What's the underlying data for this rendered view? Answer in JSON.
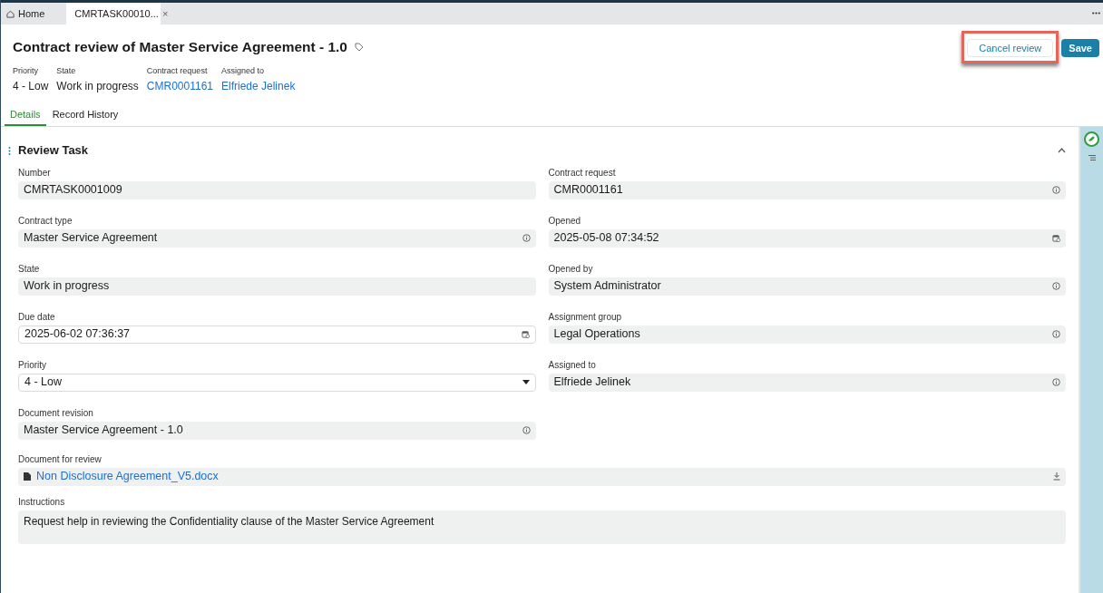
{
  "tabs": [
    {
      "label": "Home",
      "kind": "home",
      "selected": false
    },
    {
      "label": "CMRTASK00010...",
      "kind": "record",
      "close": "×",
      "selected": true
    }
  ],
  "header": {
    "title": "Contract review of Master Service Agreement - 1.0",
    "summary": [
      {
        "label": "Priority",
        "value": "4 - Low",
        "link": false
      },
      {
        "label": "State",
        "value": "Work in progress",
        "link": false
      },
      {
        "label": "Contract request",
        "value": "CMR0001161",
        "link": true
      },
      {
        "label": "Assigned to",
        "value": "Elfriede Jelinek",
        "link": true
      }
    ],
    "buttons": [
      {
        "label": "Cancel review",
        "kind": "secondary",
        "highlighted": true
      },
      {
        "label": "Save",
        "kind": "primary",
        "highlighted": false
      }
    ]
  },
  "record_tabs": [
    {
      "label": "Details",
      "selected": true
    },
    {
      "label": "Record History",
      "selected": false
    }
  ],
  "section": {
    "title": "Review Task",
    "expanded": true,
    "left_fields": [
      {
        "label": "Number",
        "value": "CMRTASK0001009",
        "editable": false,
        "kind": "plain"
      },
      {
        "label": "Contract type",
        "value": "Master Service Agreement",
        "editable": false,
        "kind": "reference"
      },
      {
        "label": "State",
        "value": "Work in progress",
        "editable": false,
        "kind": "plain"
      },
      {
        "label": "Due date",
        "value": "2025-06-02 07:36:37",
        "editable": true,
        "kind": "date"
      },
      {
        "label": "Priority",
        "value": "4 - Low",
        "editable": true,
        "kind": "select"
      },
      {
        "label": "Document revision",
        "value": "Master Service Agreement - 1.0",
        "editable": false,
        "kind": "reference"
      }
    ],
    "right_fields": [
      {
        "label": "Contract request",
        "value": "CMR0001161",
        "editable": false,
        "kind": "reference"
      },
      {
        "label": "Opened",
        "value": "2025-05-08 07:34:52",
        "editable": false,
        "kind": "date"
      },
      {
        "label": "Opened by",
        "value": "System Administrator",
        "editable": false,
        "kind": "reference"
      },
      {
        "label": "Assignment group",
        "value": "Legal Operations",
        "editable": false,
        "kind": "reference"
      },
      {
        "label": "Assigned to",
        "value": "Elfriede Jelinek",
        "editable": false,
        "kind": "reference"
      }
    ],
    "document": {
      "label": "Document for review",
      "file": "Non Disclosure Agreement_V5.docx"
    },
    "instructions": {
      "label": "Instructions",
      "value": "Request help in reviewing the Confidentiality clause of the Master Service Agreement"
    }
  }
}
